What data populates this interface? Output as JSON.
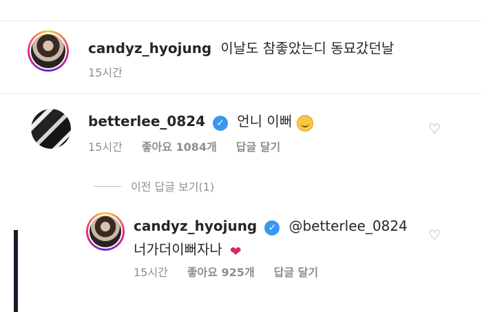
{
  "caption": {
    "username": "candyz_hyojung",
    "text": "이날도 참좋았는디 동묘갔던날",
    "time": "15시간"
  },
  "comment": {
    "username": "betterlee_0824",
    "text": "언니 이뻐",
    "time": "15시간",
    "likes": "좋아요 1084개",
    "reply_label": "답글 달기"
  },
  "view_previous_replies": "이전 답글 보기(1)",
  "reply": {
    "username": "candyz_hyojung",
    "mention": "@betterlee_0824",
    "text": "너가더이뻐자나",
    "time": "15시간",
    "likes": "좋아요 925개",
    "reply_label": "답글 달기"
  },
  "icons": {
    "verified": "verified-badge-icon",
    "like": "heart-outline-icon",
    "grinning": "smiling-emoji-icon",
    "red_heart": "red-heart-emoji-icon"
  },
  "colors": {
    "verified": "#3897f0",
    "meta_text": "#8e8e8e",
    "heart": "#e0245e"
  }
}
